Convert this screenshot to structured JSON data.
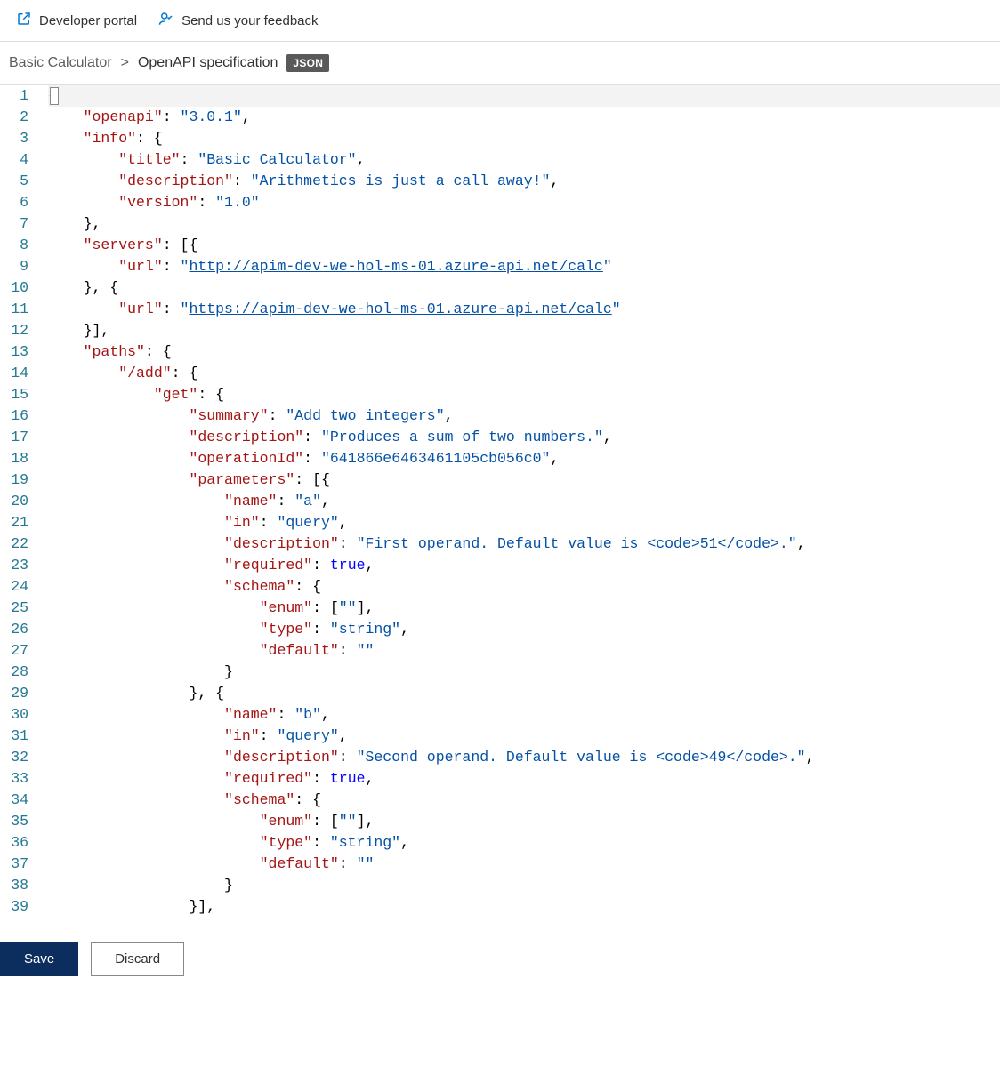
{
  "toolbar": {
    "devportal_label": "Developer portal",
    "feedback_label": "Send us your feedback"
  },
  "breadcrumb": {
    "root": "Basic Calculator",
    "sep": ">",
    "current": "OpenAPI specification",
    "badge": "JSON"
  },
  "footer": {
    "save_label": "Save",
    "discard_label": "Discard"
  },
  "code_lines": [
    {
      "n": 1,
      "indent": 0,
      "segs": [
        {
          "t": "{",
          "c": "p"
        }
      ],
      "current": true
    },
    {
      "n": 2,
      "indent": 1,
      "segs": [
        {
          "t": "\"openapi\"",
          "c": "k"
        },
        {
          "t": ": ",
          "c": "p"
        },
        {
          "t": "\"3.0.1\"",
          "c": "s"
        },
        {
          "t": ",",
          "c": "p"
        }
      ]
    },
    {
      "n": 3,
      "indent": 1,
      "segs": [
        {
          "t": "\"info\"",
          "c": "k"
        },
        {
          "t": ": {",
          "c": "p"
        }
      ]
    },
    {
      "n": 4,
      "indent": 2,
      "segs": [
        {
          "t": "\"title\"",
          "c": "k"
        },
        {
          "t": ": ",
          "c": "p"
        },
        {
          "t": "\"Basic Calculator\"",
          "c": "s"
        },
        {
          "t": ",",
          "c": "p"
        }
      ]
    },
    {
      "n": 5,
      "indent": 2,
      "segs": [
        {
          "t": "\"description\"",
          "c": "k"
        },
        {
          "t": ": ",
          "c": "p"
        },
        {
          "t": "\"Arithmetics is just a call away!\"",
          "c": "s"
        },
        {
          "t": ",",
          "c": "p"
        }
      ]
    },
    {
      "n": 6,
      "indent": 2,
      "segs": [
        {
          "t": "\"version\"",
          "c": "k"
        },
        {
          "t": ": ",
          "c": "p"
        },
        {
          "t": "\"1.0\"",
          "c": "s"
        }
      ]
    },
    {
      "n": 7,
      "indent": 1,
      "segs": [
        {
          "t": "},",
          "c": "p"
        }
      ]
    },
    {
      "n": 8,
      "indent": 1,
      "segs": [
        {
          "t": "\"servers\"",
          "c": "k"
        },
        {
          "t": ": [{",
          "c": "p"
        }
      ]
    },
    {
      "n": 9,
      "indent": 2,
      "segs": [
        {
          "t": "\"url\"",
          "c": "k"
        },
        {
          "t": ": ",
          "c": "p"
        },
        {
          "t": "\"",
          "c": "s"
        },
        {
          "t": "http://apim-dev-we-hol-ms-01.azure-api.net/calc",
          "c": "u"
        },
        {
          "t": "\"",
          "c": "s"
        }
      ]
    },
    {
      "n": 10,
      "indent": 1,
      "segs": [
        {
          "t": "}, {",
          "c": "p"
        }
      ]
    },
    {
      "n": 11,
      "indent": 2,
      "segs": [
        {
          "t": "\"url\"",
          "c": "k"
        },
        {
          "t": ": ",
          "c": "p"
        },
        {
          "t": "\"",
          "c": "s"
        },
        {
          "t": "https://apim-dev-we-hol-ms-01.azure-api.net/calc",
          "c": "u"
        },
        {
          "t": "\"",
          "c": "s"
        }
      ]
    },
    {
      "n": 12,
      "indent": 1,
      "segs": [
        {
          "t": "}],",
          "c": "p"
        }
      ]
    },
    {
      "n": 13,
      "indent": 1,
      "segs": [
        {
          "t": "\"paths\"",
          "c": "k"
        },
        {
          "t": ": {",
          "c": "p"
        }
      ]
    },
    {
      "n": 14,
      "indent": 2,
      "segs": [
        {
          "t": "\"/add\"",
          "c": "k"
        },
        {
          "t": ": {",
          "c": "p"
        }
      ]
    },
    {
      "n": 15,
      "indent": 3,
      "segs": [
        {
          "t": "\"get\"",
          "c": "k"
        },
        {
          "t": ": {",
          "c": "p"
        }
      ]
    },
    {
      "n": 16,
      "indent": 4,
      "segs": [
        {
          "t": "\"summary\"",
          "c": "k"
        },
        {
          "t": ": ",
          "c": "p"
        },
        {
          "t": "\"Add two integers\"",
          "c": "s"
        },
        {
          "t": ",",
          "c": "p"
        }
      ]
    },
    {
      "n": 17,
      "indent": 4,
      "segs": [
        {
          "t": "\"description\"",
          "c": "k"
        },
        {
          "t": ": ",
          "c": "p"
        },
        {
          "t": "\"Produces a sum of two numbers.\"",
          "c": "s"
        },
        {
          "t": ",",
          "c": "p"
        }
      ]
    },
    {
      "n": 18,
      "indent": 4,
      "segs": [
        {
          "t": "\"operationId\"",
          "c": "k"
        },
        {
          "t": ": ",
          "c": "p"
        },
        {
          "t": "\"641866e6463461105cb056c0\"",
          "c": "s"
        },
        {
          "t": ",",
          "c": "p"
        }
      ]
    },
    {
      "n": 19,
      "indent": 4,
      "segs": [
        {
          "t": "\"parameters\"",
          "c": "k"
        },
        {
          "t": ": [{",
          "c": "p"
        }
      ]
    },
    {
      "n": 20,
      "indent": 5,
      "segs": [
        {
          "t": "\"name\"",
          "c": "k"
        },
        {
          "t": ": ",
          "c": "p"
        },
        {
          "t": "\"a\"",
          "c": "s"
        },
        {
          "t": ",",
          "c": "p"
        }
      ]
    },
    {
      "n": 21,
      "indent": 5,
      "segs": [
        {
          "t": "\"in\"",
          "c": "k"
        },
        {
          "t": ": ",
          "c": "p"
        },
        {
          "t": "\"query\"",
          "c": "s"
        },
        {
          "t": ",",
          "c": "p"
        }
      ]
    },
    {
      "n": 22,
      "indent": 5,
      "segs": [
        {
          "t": "\"description\"",
          "c": "k"
        },
        {
          "t": ": ",
          "c": "p"
        },
        {
          "t": "\"First operand. Default value is <code>51</code>.\"",
          "c": "s"
        },
        {
          "t": ",",
          "c": "p"
        }
      ]
    },
    {
      "n": 23,
      "indent": 5,
      "segs": [
        {
          "t": "\"required\"",
          "c": "k"
        },
        {
          "t": ": ",
          "c": "p"
        },
        {
          "t": "true",
          "c": "b"
        },
        {
          "t": ",",
          "c": "p"
        }
      ]
    },
    {
      "n": 24,
      "indent": 5,
      "segs": [
        {
          "t": "\"schema\"",
          "c": "k"
        },
        {
          "t": ": {",
          "c": "p"
        }
      ]
    },
    {
      "n": 25,
      "indent": 6,
      "segs": [
        {
          "t": "\"enum\"",
          "c": "k"
        },
        {
          "t": ": [",
          "c": "p"
        },
        {
          "t": "\"\"",
          "c": "s"
        },
        {
          "t": "],",
          "c": "p"
        }
      ]
    },
    {
      "n": 26,
      "indent": 6,
      "segs": [
        {
          "t": "\"type\"",
          "c": "k"
        },
        {
          "t": ": ",
          "c": "p"
        },
        {
          "t": "\"string\"",
          "c": "s"
        },
        {
          "t": ",",
          "c": "p"
        }
      ]
    },
    {
      "n": 27,
      "indent": 6,
      "segs": [
        {
          "t": "\"default\"",
          "c": "k"
        },
        {
          "t": ": ",
          "c": "p"
        },
        {
          "t": "\"\"",
          "c": "s"
        }
      ]
    },
    {
      "n": 28,
      "indent": 5,
      "segs": [
        {
          "t": "}",
          "c": "p"
        }
      ]
    },
    {
      "n": 29,
      "indent": 4,
      "segs": [
        {
          "t": "}, {",
          "c": "p"
        }
      ]
    },
    {
      "n": 30,
      "indent": 5,
      "segs": [
        {
          "t": "\"name\"",
          "c": "k"
        },
        {
          "t": ": ",
          "c": "p"
        },
        {
          "t": "\"b\"",
          "c": "s"
        },
        {
          "t": ",",
          "c": "p"
        }
      ]
    },
    {
      "n": 31,
      "indent": 5,
      "segs": [
        {
          "t": "\"in\"",
          "c": "k"
        },
        {
          "t": ": ",
          "c": "p"
        },
        {
          "t": "\"query\"",
          "c": "s"
        },
        {
          "t": ",",
          "c": "p"
        }
      ]
    },
    {
      "n": 32,
      "indent": 5,
      "segs": [
        {
          "t": "\"description\"",
          "c": "k"
        },
        {
          "t": ": ",
          "c": "p"
        },
        {
          "t": "\"Second operand. Default value is <code>49</code>.\"",
          "c": "s"
        },
        {
          "t": ",",
          "c": "p"
        }
      ]
    },
    {
      "n": 33,
      "indent": 5,
      "segs": [
        {
          "t": "\"required\"",
          "c": "k"
        },
        {
          "t": ": ",
          "c": "p"
        },
        {
          "t": "true",
          "c": "b"
        },
        {
          "t": ",",
          "c": "p"
        }
      ]
    },
    {
      "n": 34,
      "indent": 5,
      "segs": [
        {
          "t": "\"schema\"",
          "c": "k"
        },
        {
          "t": ": {",
          "c": "p"
        }
      ]
    },
    {
      "n": 35,
      "indent": 6,
      "segs": [
        {
          "t": "\"enum\"",
          "c": "k"
        },
        {
          "t": ": [",
          "c": "p"
        },
        {
          "t": "\"\"",
          "c": "s"
        },
        {
          "t": "],",
          "c": "p"
        }
      ]
    },
    {
      "n": 36,
      "indent": 6,
      "segs": [
        {
          "t": "\"type\"",
          "c": "k"
        },
        {
          "t": ": ",
          "c": "p"
        },
        {
          "t": "\"string\"",
          "c": "s"
        },
        {
          "t": ",",
          "c": "p"
        }
      ]
    },
    {
      "n": 37,
      "indent": 6,
      "segs": [
        {
          "t": "\"default\"",
          "c": "k"
        },
        {
          "t": ": ",
          "c": "p"
        },
        {
          "t": "\"\"",
          "c": "s"
        }
      ]
    },
    {
      "n": 38,
      "indent": 5,
      "segs": [
        {
          "t": "}",
          "c": "p"
        }
      ]
    },
    {
      "n": 39,
      "indent": 4,
      "segs": [
        {
          "t": "}],",
          "c": "p"
        }
      ]
    }
  ]
}
